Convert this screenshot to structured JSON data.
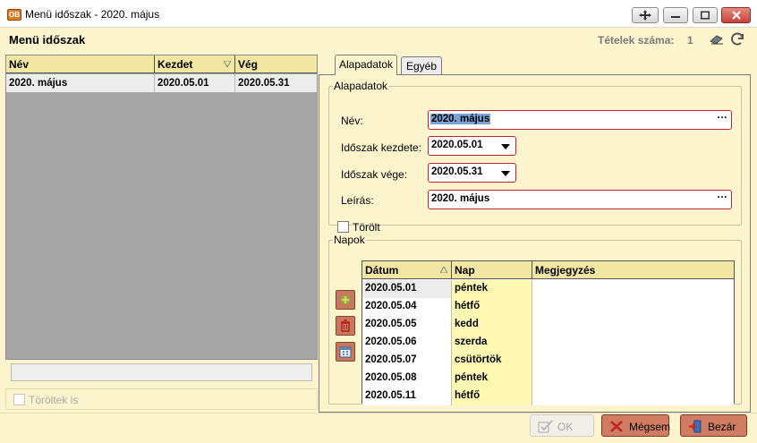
{
  "window": {
    "icon_label": "OB",
    "title": "Menü időszak - 2020. május"
  },
  "header": {
    "title": "Menü időszak",
    "count_label": "Tételek száma:",
    "count_value": "1"
  },
  "list": {
    "columns": [
      "Név",
      "Kezdet",
      "Vég"
    ],
    "rows": [
      {
        "name": "2020. május",
        "start": "2020.05.01",
        "end": "2020.05.31"
      }
    ],
    "deleted_too_label": "Töröltek is"
  },
  "tabs": {
    "active": "Alapadatok",
    "inactive": "Egyéb"
  },
  "alapadatok": {
    "legend": "Alapadatok",
    "name_label": "Név:",
    "name_value": "2020. május",
    "start_label": "Időszak kezdete:",
    "start_value": "2020.05.01",
    "end_label": "Időszak vége:",
    "end_value": "2020.05.31",
    "desc_label": "Leírás:",
    "desc_value": "2020. május",
    "deleted_label": "Törölt",
    "ellipsis": "···"
  },
  "napok": {
    "legend": "Napok",
    "columns": [
      "Dátum",
      "Nap",
      "Megjegyzés"
    ],
    "rows": [
      {
        "date": "2020.05.01",
        "day": "péntek",
        "note": ""
      },
      {
        "date": "2020.05.04",
        "day": "hétfő",
        "note": ""
      },
      {
        "date": "2020.05.05",
        "day": "kedd",
        "note": ""
      },
      {
        "date": "2020.05.06",
        "day": "szerda",
        "note": ""
      },
      {
        "date": "2020.05.07",
        "day": "csütörtök",
        "note": ""
      },
      {
        "date": "2020.05.08",
        "day": "péntek",
        "note": ""
      },
      {
        "date": "2020.05.11",
        "day": "hétfő",
        "note": ""
      }
    ]
  },
  "buttons": {
    "ok": "OK",
    "cancel": "Mégsem",
    "close": "Bezár"
  },
  "colors": {
    "background": "#fbf4cd",
    "header_fill": "#f2e6a3",
    "required_border": "#c0262a",
    "button_fill": "#cf7c63"
  }
}
